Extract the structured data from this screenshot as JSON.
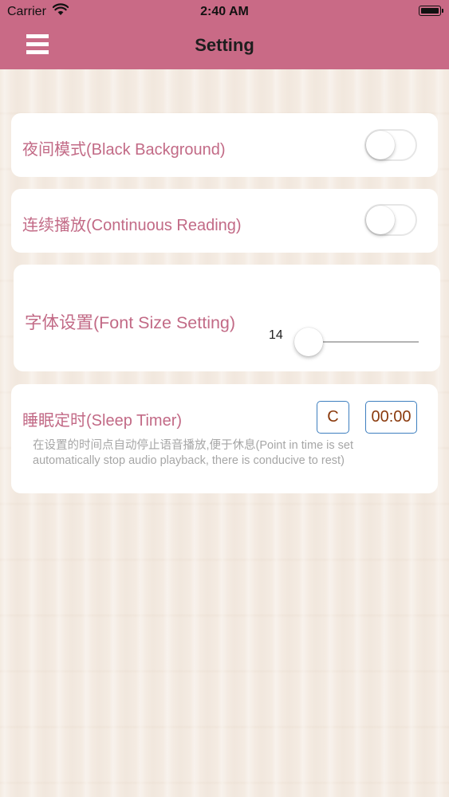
{
  "status_bar": {
    "carrier": "Carrier",
    "time": "2:40 AM"
  },
  "header": {
    "title": "Setting"
  },
  "colors": {
    "header": "#c96a86",
    "label": "#c26a86",
    "timer_border": "#3e7fbf",
    "timer_text": "#8a3a0d"
  },
  "settings": {
    "night_mode": {
      "label": "夜间模式(Black Background)",
      "enabled": false
    },
    "continuous_reading": {
      "label": "连续播放(Continuous Reading)",
      "enabled": false
    },
    "font_size": {
      "label": "字体设置(Font Size Setting)",
      "value": "14"
    },
    "sleep_timer": {
      "label": "睡眠定时(Sleep Timer)",
      "cancel_label": "C",
      "time": "00:00",
      "description": "在设置的时间点自动停止语音播放,便于休息(Point in time is set automatically stop audio playback, there is conducive to rest)"
    }
  }
}
